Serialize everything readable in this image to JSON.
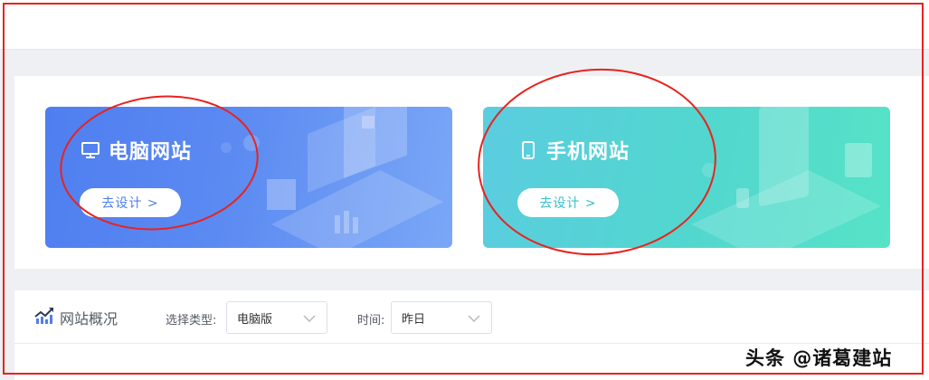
{
  "cards": [
    {
      "title": "电脑网站",
      "button": "去设计 >",
      "icon": "monitor-icon"
    },
    {
      "title": "手机网站",
      "button": "去设计 >",
      "icon": "phone-icon"
    }
  ],
  "overview": {
    "title": "网站概况",
    "icon": "trend-chart-icon",
    "type_label": "选择类型:",
    "type_value": "电脑版",
    "time_label": "时间:",
    "time_value": "昨日"
  },
  "watermark": "头条 @诸葛建站",
  "colors": {
    "pc_card": "#4f7ef0",
    "mobile_card": "#52d6cf",
    "annotation_red": "#e8231e"
  }
}
